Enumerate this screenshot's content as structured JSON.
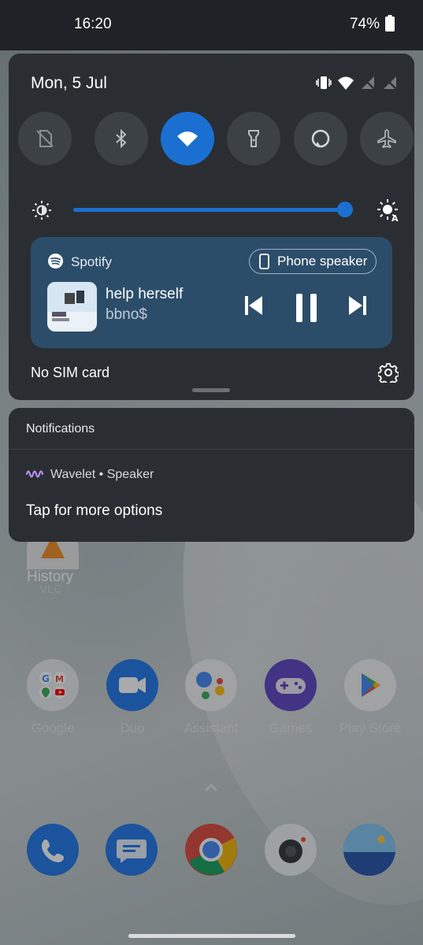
{
  "status_bar": {
    "time": "16:20",
    "battery_percent": "74%"
  },
  "quick_settings": {
    "date": "Mon, 5 Jul",
    "tiles": [
      {
        "name": "no-sim-tile",
        "icon": "sim-off-icon",
        "active": false
      },
      {
        "name": "bluetooth-tile",
        "icon": "bluetooth-icon",
        "active": false
      },
      {
        "name": "wifi-tile",
        "icon": "wifi-icon",
        "active": true
      },
      {
        "name": "flashlight-tile",
        "icon": "flashlight-icon",
        "active": false
      },
      {
        "name": "alexa-tile",
        "icon": "alexa-icon",
        "active": false
      },
      {
        "name": "airplane-tile",
        "icon": "airplane-icon",
        "active": false
      }
    ],
    "brightness_level": 0.99,
    "sim_status": "No SIM card"
  },
  "media": {
    "app_name": "Spotify",
    "output_device": "Phone speaker",
    "track_title": "help herself",
    "artist": "bbno$"
  },
  "notifications": {
    "header": "Notifications",
    "items": [
      {
        "app": "Wavelet",
        "channel": "Speaker",
        "app_line": "Wavelet • Speaker",
        "body": "Tap for more options"
      }
    ]
  },
  "home_screen": {
    "history_label": "History",
    "history_sublabel": "VLC",
    "apps": [
      {
        "label": "Google"
      },
      {
        "label": "Duo"
      },
      {
        "label": "Assistant"
      },
      {
        "label": "Games"
      },
      {
        "label": "Play Store"
      }
    ],
    "dock": [
      "phone-icon",
      "messages-icon",
      "chrome-icon",
      "camera-icon",
      "gallery-icon"
    ]
  },
  "colors": {
    "panel_bg": "#2a2e32",
    "accent": "#1a6fd1",
    "media_card": "#2c4d6a"
  }
}
